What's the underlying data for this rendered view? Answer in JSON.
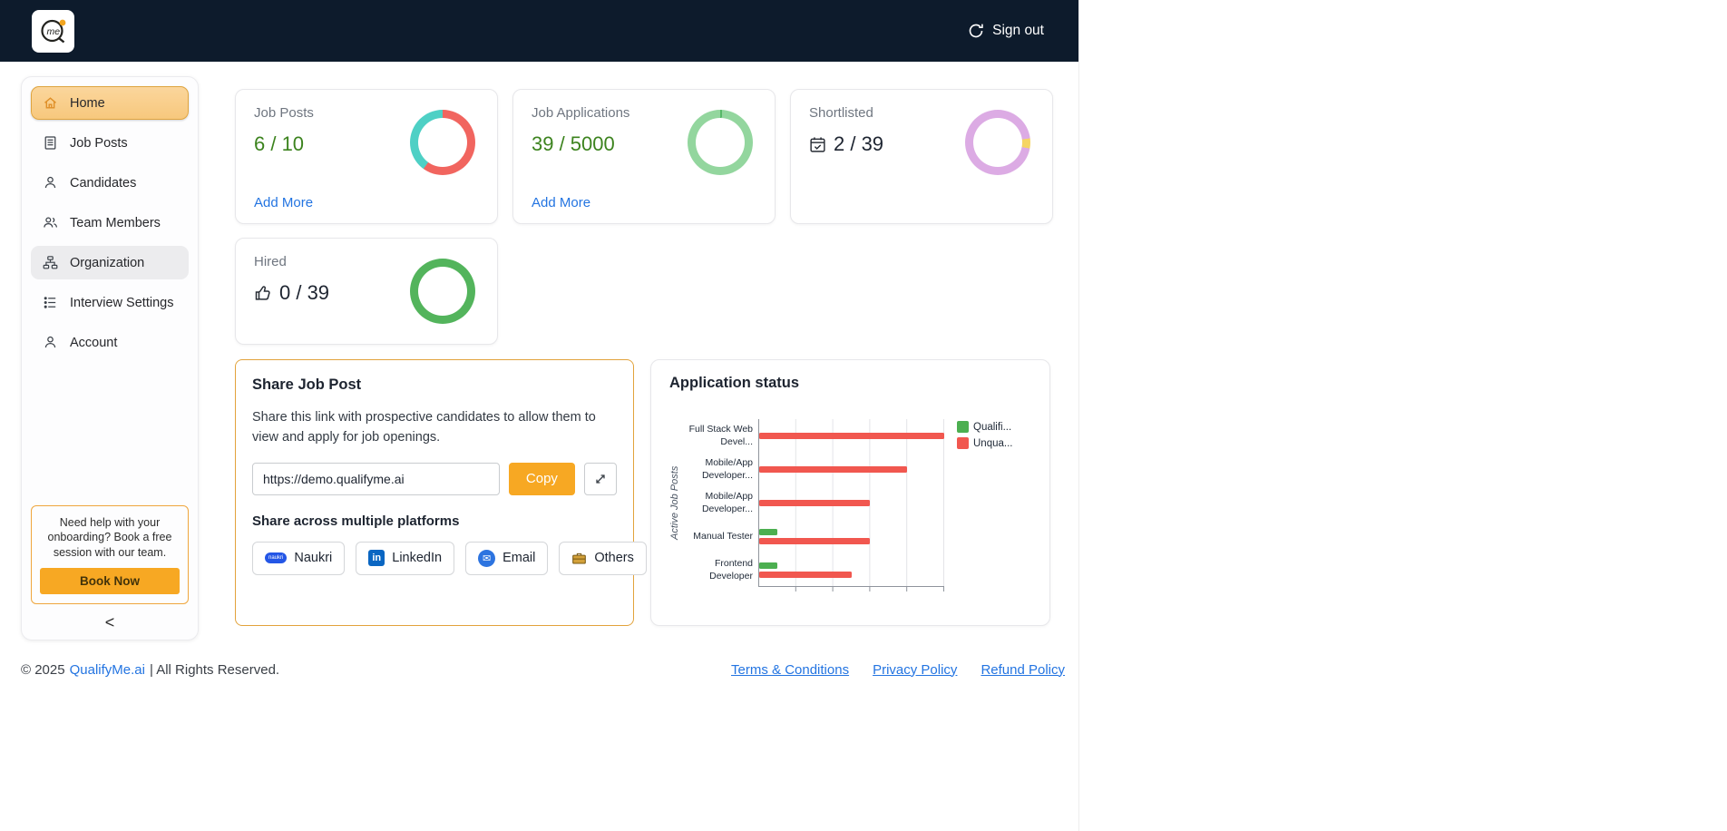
{
  "navbar": {
    "logo_text": "me",
    "sign_out_label": "Sign out"
  },
  "sidebar": {
    "items": [
      {
        "label": "Home",
        "active": true
      },
      {
        "label": "Job Posts"
      },
      {
        "label": "Candidates"
      },
      {
        "label": "Team Members"
      },
      {
        "label": "Organization"
      },
      {
        "label": "Interview Settings"
      },
      {
        "label": "Account"
      }
    ],
    "help": {
      "text": "Need help with your onboarding? Book a free session with our team.",
      "button_label": "Book Now"
    },
    "collapse_label": "<"
  },
  "stats": [
    {
      "title": "Job Posts",
      "value": "6 / 10",
      "link_label": "Add More",
      "donut": {
        "segments": [
          {
            "color": "#f1655f",
            "pct": 60
          },
          {
            "color": "#4ed0c5",
            "pct": 40
          }
        ]
      }
    },
    {
      "title": "Job Applications",
      "value": "39 / 5000",
      "link_label": "Add More",
      "donut": {
        "segments": [
          {
            "color": "#57b868",
            "pct": 1
          },
          {
            "color": "#93d69e",
            "pct": 99
          }
        ]
      }
    },
    {
      "title": "Shortlisted",
      "value": "2 / 39",
      "icon": "calendar-check",
      "donut": {
        "segments": [
          {
            "color": "#dcabe4",
            "pct": 23
          },
          {
            "color": "#f5d564",
            "pct": 5
          },
          {
            "color": "#dcabe4",
            "pct": 72
          }
        ]
      }
    },
    {
      "title": "Hired",
      "value": "0 / 39",
      "icon": "thumbs-up",
      "donut": {
        "segments": [
          {
            "color": "#53b45c",
            "pct": 100
          }
        ]
      }
    }
  ],
  "share": {
    "title": "Share Job Post",
    "description": "Share this link with prospective candidates to allow them to view and apply for job openings.",
    "url": "https://demo.qualifyme.ai",
    "copy_label": "Copy",
    "platforms_title": "Share across multiple platforms",
    "platforms": [
      {
        "label": "Naukri",
        "icon_text": "naukri"
      },
      {
        "label": "LinkedIn",
        "icon_text": "in"
      },
      {
        "label": "Email",
        "icon_text": "✉"
      },
      {
        "label": "Others"
      }
    ]
  },
  "application_status": {
    "title": "Application status",
    "chart_data": {
      "type": "bar",
      "orientation": "horizontal",
      "title": "Application status",
      "ylabel": "Active Job Posts",
      "xlabel": "",
      "categories": [
        "Full Stack Web Devel...",
        "Mobile/App Developer...",
        "Mobile/App Developer...",
        "Manual Tester",
        "Frontend Developer"
      ],
      "series": [
        {
          "name": "Qualifi...",
          "color": "#4caf50",
          "values": [
            0,
            0,
            0,
            1,
            1
          ]
        },
        {
          "name": "Unqua...",
          "color": "#f1574f",
          "values": [
            10,
            8,
            6,
            6,
            5
          ]
        }
      ],
      "xlim": [
        0,
        10
      ],
      "grid": true,
      "legend_position": "top-right"
    }
  },
  "footer": {
    "copyright_prefix": "© 2025",
    "brand_link": "QualifyMe.ai",
    "copyright_suffix": "| All Rights Reserved.",
    "links": [
      {
        "label": "Terms & Conditions"
      },
      {
        "label": "Privacy Policy"
      },
      {
        "label": "Refund Policy"
      }
    ]
  }
}
